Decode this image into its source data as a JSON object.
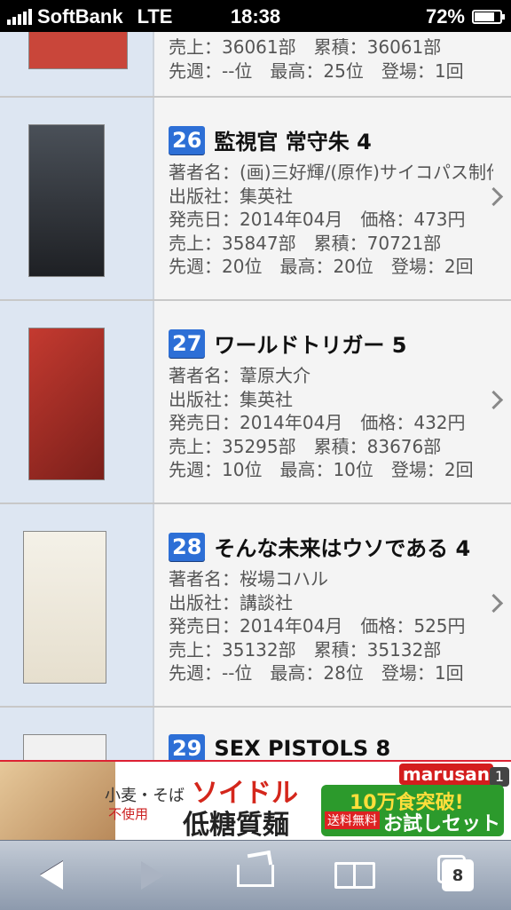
{
  "status": {
    "carrier": "SoftBank",
    "network": "LTE",
    "time": "18:38",
    "battery": "72%",
    "battery_level": 0.72
  },
  "partial_top": {
    "sales": "売上：36061部　累積：36061部",
    "week": "先週：--位　最高：25位　登場：1回"
  },
  "items": [
    {
      "rank": "26",
      "title": "監視官 常守朱 4",
      "author": "著者名：(画)三好輝/(原作)サイコパス制作",
      "publisher": "出版社：集英社",
      "release": "発売日：2014年04月　価格：473円",
      "sales": "売上：35847部　累積：70721部",
      "week": "先週：20位　最高：20位　登場：2回",
      "cover_color": "#2c2c2c"
    },
    {
      "rank": "27",
      "title": "ワールドトリガー 5",
      "author": "著者名：葦原大介",
      "publisher": "出版社：集英社",
      "release": "発売日：2014年04月　価格：432円",
      "sales": "売上：35295部　累積：83676部",
      "week": "先週：10位　最高：10位　登場：2回",
      "cover_color": "#b8332a"
    },
    {
      "rank": "28",
      "title": "そんな未来はウソである 4",
      "author": "著者名：桜場コハル",
      "publisher": "出版社：講談社",
      "release": "発売日：2014年04月　価格：525円",
      "sales": "売上：35132部　累積：35132部",
      "week": "先週：--位　最高：28位　登場：1回",
      "cover_color": "#f0ede4"
    }
  ],
  "partial_bottom": {
    "rank": "29",
    "title": "SEX PISTOLS 8"
  },
  "ad": {
    "line1": "小麦・そば",
    "line2": "不使用",
    "headline": "ソイドル",
    "product": "低糖質麺",
    "brand": "marusan",
    "cta_top": "10万食突破!",
    "cta_badge": "送料無料",
    "cta_main": "お試しセット",
    "close": "1"
  },
  "toolbar": {
    "tab_count": "8"
  }
}
